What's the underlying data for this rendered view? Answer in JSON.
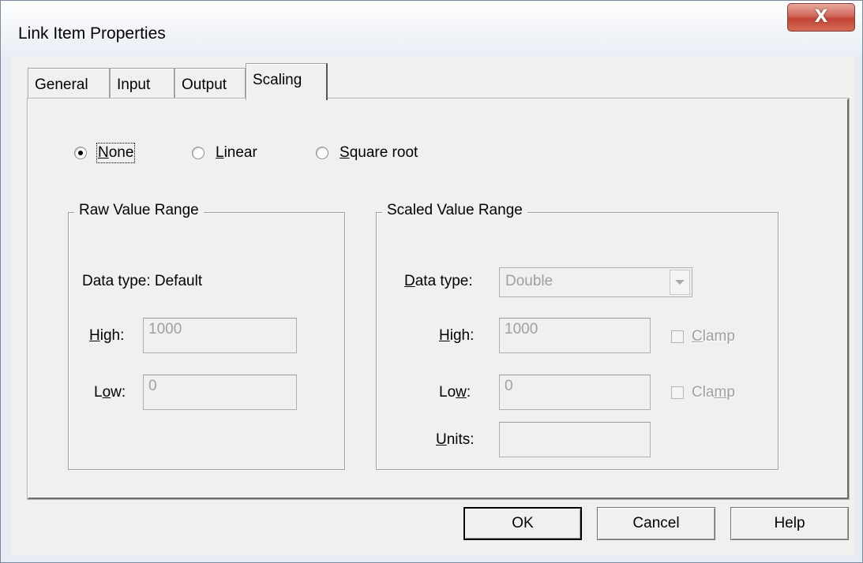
{
  "window": {
    "title": "Link Item Properties",
    "close_symbol": "X"
  },
  "tabs": [
    {
      "label": "General",
      "active": false
    },
    {
      "label": "Input",
      "active": false
    },
    {
      "label": "Output",
      "active": false
    },
    {
      "label": "Scaling",
      "active": true
    }
  ],
  "scaling_mode": {
    "options": [
      {
        "label": "None",
        "checked": true
      },
      {
        "label": "Linear",
        "checked": false
      },
      {
        "label": "Square root",
        "checked": false
      }
    ]
  },
  "raw_range": {
    "title": "Raw Value Range",
    "data_type_label": "Data type:",
    "data_type_value": "Default",
    "high_label": "High:",
    "high_value": "1000",
    "low_label": "Low:",
    "low_value": "0"
  },
  "scaled_range": {
    "title": "Scaled Value Range",
    "data_type_label": "Data type:",
    "data_type_value": "Double",
    "high_label": "High:",
    "high_value": "1000",
    "low_label": "Low:",
    "low_value": "0",
    "units_label": "Units:",
    "units_value": "",
    "clamp_high_label": "Clamp",
    "clamp_high_checked": false,
    "clamp_low_label": "Clamp",
    "clamp_low_checked": false
  },
  "buttons": {
    "ok": "OK",
    "cancel": "Cancel",
    "help": "Help"
  },
  "colors": {
    "close_button": "#c24535",
    "disabled_text": "#a0a0a0",
    "dialog_bg": "#f0f0f0"
  }
}
